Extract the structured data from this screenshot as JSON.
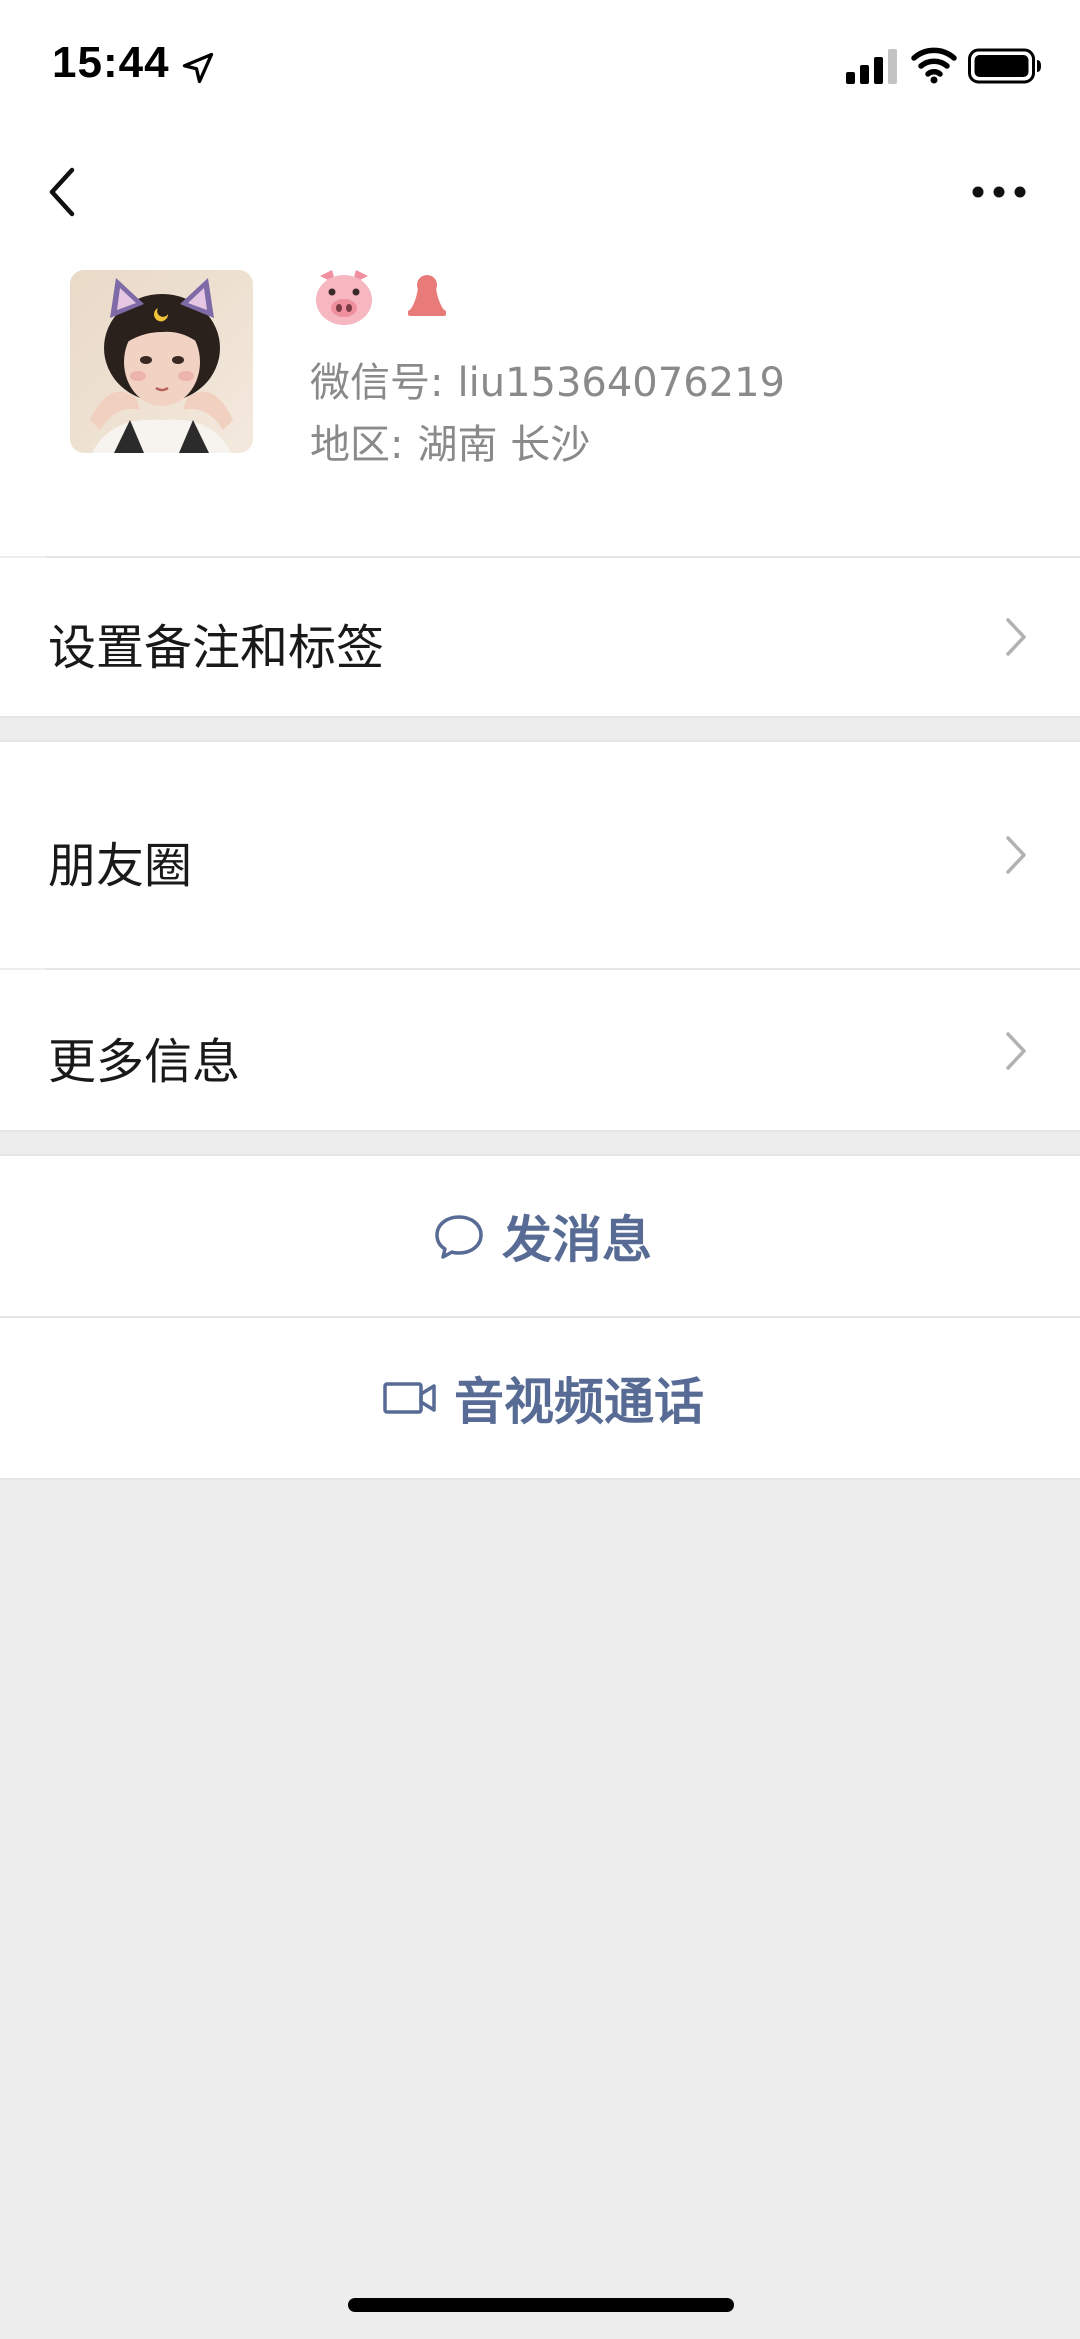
{
  "status_bar": {
    "time": "15:44"
  },
  "profile": {
    "wechat_id_label": "微信号:",
    "wechat_id": "liu15364076219",
    "region_label": "地区:",
    "region": "湖南 长沙"
  },
  "menu": {
    "remark_tags": "设置备注和标签",
    "moments": "朋友圈",
    "more_info": "更多信息"
  },
  "actions": {
    "send_message": "发消息",
    "video_call": "音视频通话"
  },
  "colors": {
    "accent": "#576b95",
    "background": "#ededed",
    "female_icon": "#e87a7a"
  },
  "icons": [
    "location-arrow-icon",
    "signal-icon",
    "wifi-icon",
    "battery-icon",
    "back-chevron-icon",
    "more-dots-icon",
    "pig-emoji-icon",
    "female-gender-icon",
    "chevron-right-icon",
    "chat-bubble-icon",
    "video-camera-icon"
  ]
}
